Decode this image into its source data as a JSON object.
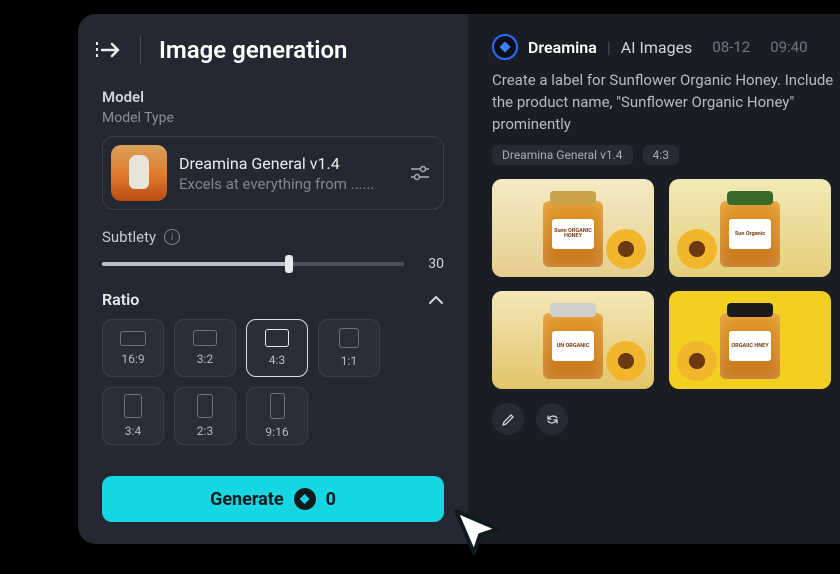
{
  "header": {
    "title": "Image generation"
  },
  "model": {
    "section_label": "Model",
    "type_label": "Model Type",
    "name": "Dreamina General v1.4",
    "description": "Excels at everything from ......"
  },
  "subtlety": {
    "label": "Subtlety",
    "value": "30"
  },
  "ratio": {
    "label": "Ratio",
    "options": [
      "16:9",
      "3:2",
      "4:3",
      "1:1",
      "3:4",
      "2:3",
      "9:16"
    ],
    "selected": "4:3",
    "shapes": {
      "16:9": [
        26,
        15
      ],
      "3:2": [
        24,
        16
      ],
      "4:3": [
        24,
        18
      ],
      "1:1": [
        20,
        20
      ],
      "3:4": [
        18,
        24
      ],
      "2:3": [
        16,
        24
      ],
      "9:16": [
        15,
        26
      ]
    }
  },
  "generate": {
    "label": "Generate",
    "cost": "0",
    "color": "#16d6e3"
  },
  "result": {
    "brand": "Dreamina",
    "section": "AI Images",
    "date": "08-12",
    "time": "09:40",
    "prompt": "Create a label for Sunflower Organic Honey. Include the product name, \"Sunflower Organic Honey\" prominently",
    "chips": [
      "Dreamina General v1.4",
      "4:3"
    ],
    "thumbs": [
      {
        "bg": "linear-gradient(180deg,#f4eac5,#e6cf8e)",
        "lid": "#c9a24a",
        "label": "Sunn ORGANIC HONEY",
        "sun_side": "right"
      },
      {
        "bg": "linear-gradient(180deg,#f2e9b6,#e4cf7a)",
        "lid": "#3a6a2a",
        "label": "Sun Organic",
        "sun_side": "left"
      },
      {
        "bg": "linear-gradient(180deg,#f5e8b8,#e2c469)",
        "lid": "#d0cfcb",
        "label": "UN ORGANIC",
        "sun_side": "right"
      },
      {
        "bg": "#f3cf1f",
        "lid": "#1b1b1b",
        "label": "ORGAIIC HNEY",
        "sun_side": "left"
      }
    ]
  }
}
